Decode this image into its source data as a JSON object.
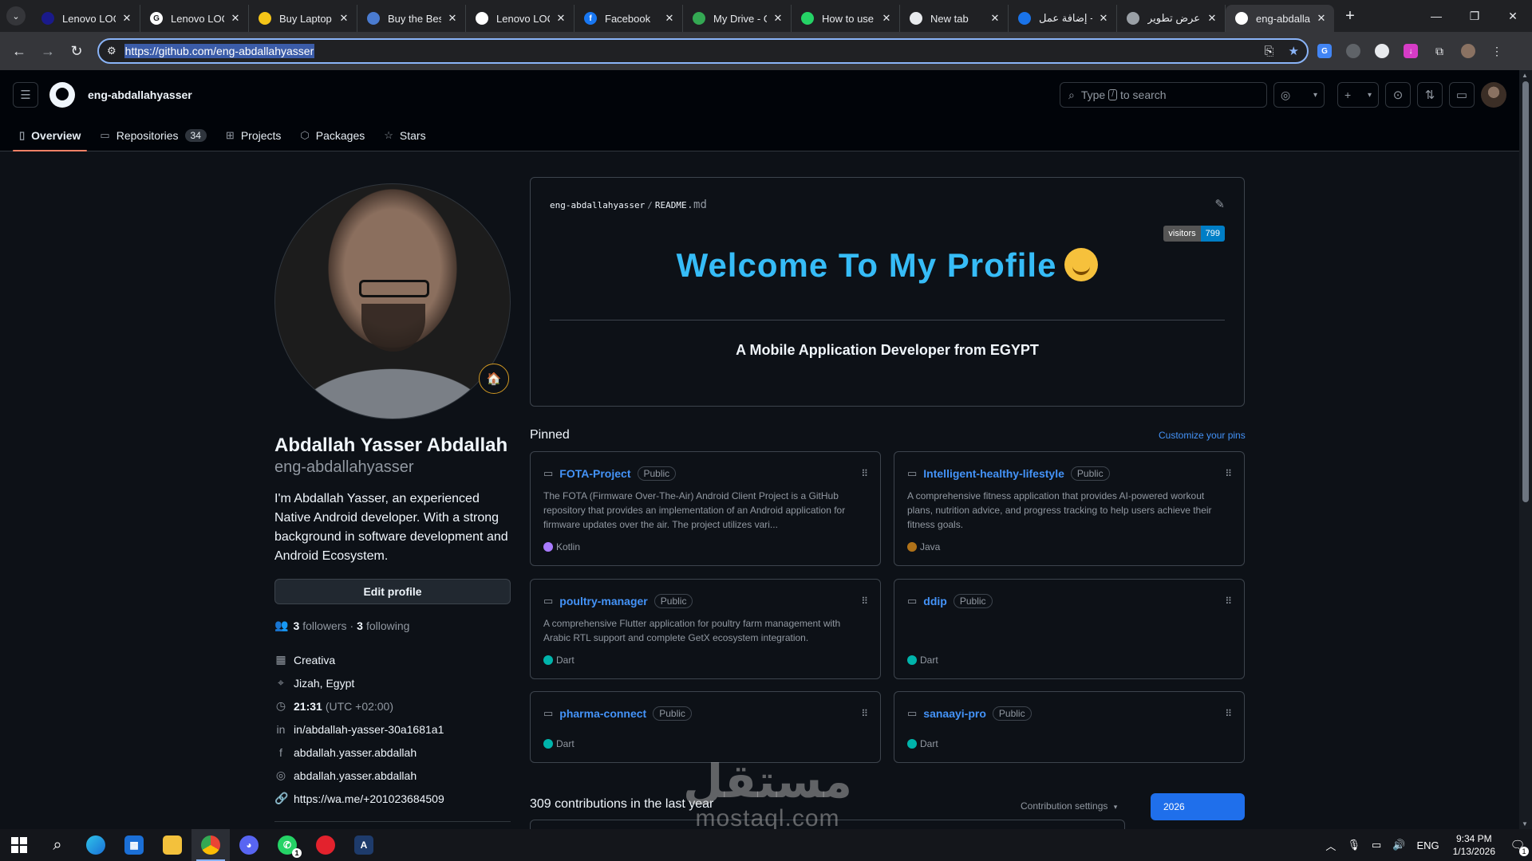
{
  "browser": {
    "tabs": [
      {
        "label": "Lenovo LOQ",
        "fav_color": "#1a1a8a",
        "fav": ""
      },
      {
        "label": "Lenovo LOQ",
        "fav_color": "#ffffff",
        "fav": "G"
      },
      {
        "label": "Buy Laptop f",
        "fav_color": "#f5c518",
        "fav": ""
      },
      {
        "label": "Buy the Best",
        "fav_color": "#4a7bd0",
        "fav": ""
      },
      {
        "label": "Lenovo LOQ",
        "fav_color": "#ffffff",
        "fav": ""
      },
      {
        "label": "Facebook",
        "fav_color": "#1877f2",
        "fav": "f"
      },
      {
        "label": "My Drive - G",
        "fav_color": "#34a853",
        "fav": ""
      },
      {
        "label": "How to use",
        "fav_color": "#25d366",
        "fav": ""
      },
      {
        "label": "New tab",
        "fav_color": "#e8eaed",
        "fav": ""
      },
      {
        "label": "إضافة عمل -",
        "fav_color": "#1a73e8",
        "fav": ""
      },
      {
        "label": "عرض تطوير",
        "fav_color": "#9aa0a6",
        "fav": ""
      },
      {
        "label": "eng-abdallal",
        "fav_color": "#ffffff",
        "fav": ""
      }
    ],
    "active_tab": 11,
    "url": "https://github.com/eng-abdallahyasser"
  },
  "github": {
    "username": "eng-abdallahyasser",
    "search_placeholder_pre": "Type",
    "search_key": "/",
    "search_placeholder_post": "to search",
    "tabs": {
      "overview": "Overview",
      "repositories": "Repositories",
      "repositories_count": "34",
      "projects": "Projects",
      "packages": "Packages",
      "stars": "Stars"
    }
  },
  "profile": {
    "name": "Abdallah Yasser Abdallah",
    "login": "eng-abdallahyasser",
    "bio": "I'm Abdallah Yasser, an experienced Native Android developer. With a strong background in software development and Android Ecosystem.",
    "edit_label": "Edit profile",
    "followers_count": "3",
    "followers_label": "followers",
    "following_count": "3",
    "following_label": "following",
    "dot": "·",
    "company": "Creativa",
    "location": "Jizah, Egypt",
    "time": "21:31",
    "timezone": "(UTC +02:00)",
    "linkedin": "in/abdallah-yasser-30a1681a1",
    "facebook": "abdallah.yasser.abdallah",
    "instagram": "abdallah.yasser.abdallah",
    "website": "https://wa.me/+201023684509"
  },
  "readme": {
    "owner": "eng-abdallahyasser",
    "slash": "/",
    "file": "README",
    "ext": ".md",
    "visitors_label": "visitors",
    "visitors_count": "799",
    "welcome": "Welcome To My Profile",
    "tagline": "A Mobile Application Developer from EGYPT"
  },
  "pinned": {
    "title": "Pinned",
    "customize": "Customize your pins",
    "repos": [
      {
        "name": "FOTA-Project",
        "visibility": "Public",
        "desc": "The FOTA (Firmware Over-The-Air) Android Client Project is a GitHub repository that provides an implementation of an Android application for firmware updates over the air. The project utilizes vari...",
        "lang": "Kotlin",
        "lang_color": "#a97bff"
      },
      {
        "name": "Intelligent-healthy-lifestyle",
        "visibility": "Public",
        "desc": "A comprehensive fitness application that provides AI-powered workout plans, nutrition advice, and progress tracking to help users achieve their fitness goals.",
        "lang": "Java",
        "lang_color": "#b07219"
      },
      {
        "name": "poultry-manager",
        "visibility": "Public",
        "desc": "A comprehensive Flutter application for poultry farm management with Arabic RTL support and complete GetX ecosystem integration.",
        "lang": "Dart",
        "lang_color": "#00b4ab"
      },
      {
        "name": "ddip",
        "visibility": "Public",
        "desc": "",
        "lang": "Dart",
        "lang_color": "#00b4ab"
      },
      {
        "name": "pharma-connect",
        "visibility": "Public",
        "desc": "",
        "lang": "Dart",
        "lang_color": "#00b4ab"
      },
      {
        "name": "sanaayi-pro",
        "visibility": "Public",
        "desc": "",
        "lang": "Dart",
        "lang_color": "#00b4ab"
      }
    ]
  },
  "contributions": {
    "summary": "309 contributions in the last year",
    "settings": "Contribution settings",
    "year": "2026"
  },
  "watermark": {
    "arabic": "مستقل",
    "latin": "mostaql.com"
  },
  "taskbar": {
    "whatsapp_badge": "1",
    "lang": "ENG",
    "time": "9:34 PM",
    "date": "1/13/2026",
    "notif_count": "1"
  }
}
